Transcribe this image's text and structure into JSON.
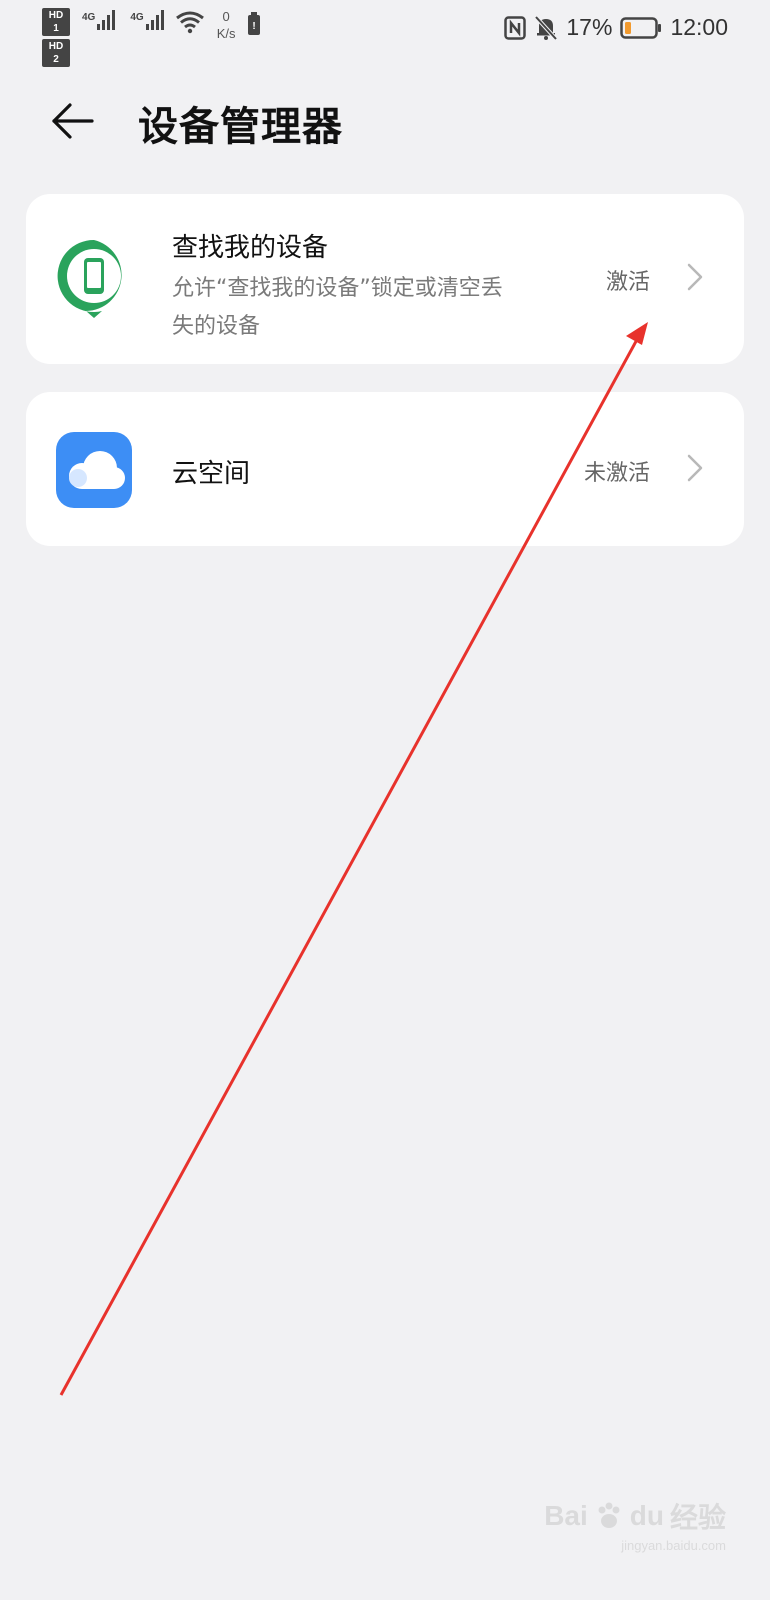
{
  "status_bar": {
    "sim1": "HD 1",
    "sim2": "HD 2",
    "net1": "4G",
    "net2": "4G",
    "speed_value": "0",
    "speed_unit": "K/s",
    "battery_percent": "17%",
    "time": "12:00",
    "icons": [
      "signal-icon",
      "wifi-icon",
      "battery-saver-icon",
      "nfc-icon",
      "mute-bell-icon",
      "battery-icon"
    ]
  },
  "header": {
    "title": "设备管理器",
    "back_icon": "back-arrow-icon"
  },
  "items": [
    {
      "title": "查找我的设备",
      "subtitle": "允许“查找我的设备”锁定或清空丢失的设备",
      "status": "激活",
      "icon": "find-device-icon",
      "icon_color": "#2aa35c"
    },
    {
      "title": "云空间",
      "subtitle": "",
      "status": "未激活",
      "icon": "cloud-icon",
      "icon_color": "#3d8ef5"
    }
  ],
  "annotation": {
    "arrow_color": "#e8322c"
  },
  "watermark": {
    "brand": "Bai",
    "brand2": "du",
    "brand3": "经验",
    "url": "jingyan.baidu.com"
  }
}
